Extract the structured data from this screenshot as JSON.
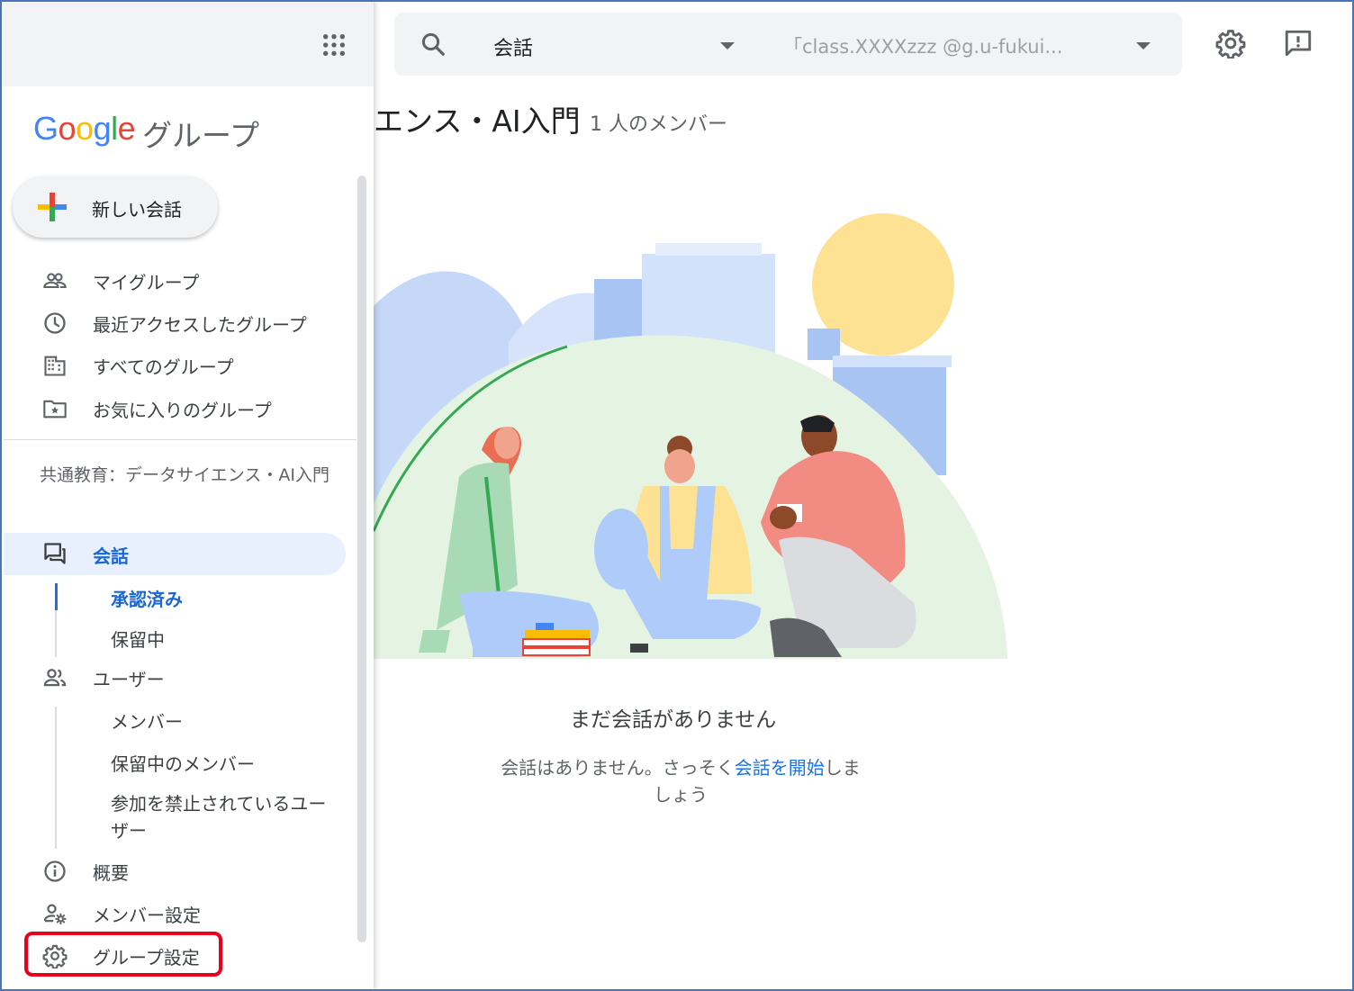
{
  "topbar": {
    "search_scope": "会話",
    "filter_placeholder": "「class.XXXXzzz @g.u-fukui...",
    "settings_icon": "gear-icon",
    "feedback_icon": "feedback-icon"
  },
  "main": {
    "group_title": "エンス・AI入門",
    "member_count": "1 人のメンバー",
    "empty_title": "まだ会話がありません",
    "empty_desc_before": "会話はありません。さっそく",
    "empty_desc_link": "会話を開始",
    "empty_desc_after": "しましょう"
  },
  "sidebar": {
    "logo_text": "Google",
    "product_name": "グループ",
    "compose_label": "新しい会話",
    "nav": [
      {
        "label": "マイグループ",
        "icon": "people-icon"
      },
      {
        "label": "最近アクセスしたグループ",
        "icon": "clock-icon"
      },
      {
        "label": "すべてのグループ",
        "icon": "building-icon"
      },
      {
        "label": "お気に入りのグループ",
        "icon": "star-folder-icon"
      }
    ],
    "group_name": "共通教育：データサイエンス・AI入門",
    "conversations_label": "会話",
    "conversations_sub": [
      "承認済み",
      "保留中"
    ],
    "users_label": "ユーザー",
    "users_sub": [
      "メンバー",
      "保留中のメンバー",
      "参加を禁止されているユーザー"
    ],
    "about_label": "概要",
    "member_settings_label": "メンバー設定",
    "group_settings_label": "グループ設定"
  },
  "colors": {
    "accent": "#1a73e8",
    "active_bg": "#e8f0fe",
    "highlight": "#e8001c"
  }
}
